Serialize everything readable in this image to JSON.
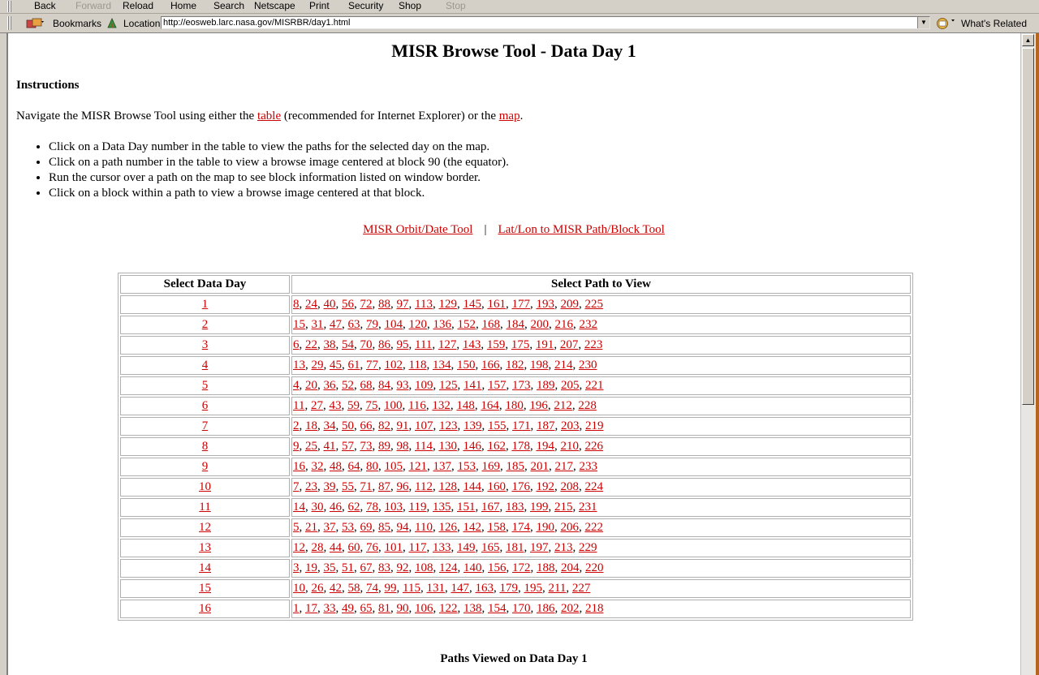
{
  "nav": {
    "back": "Back",
    "forward": "Forward",
    "reload": "Reload",
    "home": "Home",
    "search": "Search",
    "netscape": "Netscape",
    "print": "Print",
    "security": "Security",
    "shop": "Shop",
    "stop": "Stop"
  },
  "location_bar": {
    "bookmarks": "Bookmarks",
    "location_label": "Location:",
    "url": "http://eosweb.larc.nasa.gov/MISRBR/day1.html",
    "whats_related": "What's Related"
  },
  "page": {
    "title": "MISR Browse Tool - Data Day 1",
    "instructions_heading": "Instructions",
    "intro": {
      "before": "Navigate the MISR Browse Tool using either the ",
      "link_table": "table",
      "middle": " (recommended for Internet Explorer) or the ",
      "link_map": "map",
      "after": "."
    },
    "bullets": [
      "Click on a Data Day number in the table to view the paths for the selected day on the map.",
      "Click on a path number in the table to view a browse image centered at block 90 (the equator).",
      "Run the cursor over a path on the map to see block information listed on window border.",
      "Click on a block within a path to view a browse image centered at that block."
    ],
    "tool_links": {
      "orbit_date": "MISR Orbit/Date Tool",
      "separator": "|",
      "latlon": "Lat/Lon to MISR Path/Block Tool"
    },
    "table": {
      "col_day": "Select Data Day",
      "col_paths": "Select Path to View",
      "rows": [
        {
          "day": "1",
          "paths": [
            "8",
            "24",
            "40",
            "56",
            "72",
            "88",
            "97",
            "113",
            "129",
            "145",
            "161",
            "177",
            "193",
            "209",
            "225"
          ]
        },
        {
          "day": "2",
          "paths": [
            "15",
            "31",
            "47",
            "63",
            "79",
            "104",
            "120",
            "136",
            "152",
            "168",
            "184",
            "200",
            "216",
            "232"
          ]
        },
        {
          "day": "3",
          "paths": [
            "6",
            "22",
            "38",
            "54",
            "70",
            "86",
            "95",
            "111",
            "127",
            "143",
            "159",
            "175",
            "191",
            "207",
            "223"
          ]
        },
        {
          "day": "4",
          "paths": [
            "13",
            "29",
            "45",
            "61",
            "77",
            "102",
            "118",
            "134",
            "150",
            "166",
            "182",
            "198",
            "214",
            "230"
          ]
        },
        {
          "day": "5",
          "paths": [
            "4",
            "20",
            "36",
            "52",
            "68",
            "84",
            "93",
            "109",
            "125",
            "141",
            "157",
            "173",
            "189",
            "205",
            "221"
          ]
        },
        {
          "day": "6",
          "paths": [
            "11",
            "27",
            "43",
            "59",
            "75",
            "100",
            "116",
            "132",
            "148",
            "164",
            "180",
            "196",
            "212",
            "228"
          ]
        },
        {
          "day": "7",
          "paths": [
            "2",
            "18",
            "34",
            "50",
            "66",
            "82",
            "91",
            "107",
            "123",
            "139",
            "155",
            "171",
            "187",
            "203",
            "219"
          ]
        },
        {
          "day": "8",
          "paths": [
            "9",
            "25",
            "41",
            "57",
            "73",
            "89",
            "98",
            "114",
            "130",
            "146",
            "162",
            "178",
            "194",
            "210",
            "226"
          ]
        },
        {
          "day": "9",
          "paths": [
            "16",
            "32",
            "48",
            "64",
            "80",
            "105",
            "121",
            "137",
            "153",
            "169",
            "185",
            "201",
            "217",
            "233"
          ]
        },
        {
          "day": "10",
          "paths": [
            "7",
            "23",
            "39",
            "55",
            "71",
            "87",
            "96",
            "112",
            "128",
            "144",
            "160",
            "176",
            "192",
            "208",
            "224"
          ]
        },
        {
          "day": "11",
          "paths": [
            "14",
            "30",
            "46",
            "62",
            "78",
            "103",
            "119",
            "135",
            "151",
            "167",
            "183",
            "199",
            "215",
            "231"
          ]
        },
        {
          "day": "12",
          "paths": [
            "5",
            "21",
            "37",
            "53",
            "69",
            "85",
            "94",
            "110",
            "126",
            "142",
            "158",
            "174",
            "190",
            "206",
            "222"
          ]
        },
        {
          "day": "13",
          "paths": [
            "12",
            "28",
            "44",
            "60",
            "76",
            "101",
            "117",
            "133",
            "149",
            "165",
            "181",
            "197",
            "213",
            "229"
          ]
        },
        {
          "day": "14",
          "paths": [
            "3",
            "19",
            "35",
            "51",
            "67",
            "83",
            "92",
            "108",
            "124",
            "140",
            "156",
            "172",
            "188",
            "204",
            "220"
          ]
        },
        {
          "day": "15",
          "paths": [
            "10",
            "26",
            "42",
            "58",
            "74",
            "99",
            "115",
            "131",
            "147",
            "163",
            "179",
            "195",
            "211",
            "227"
          ]
        },
        {
          "day": "16",
          "paths": [
            "1",
            "17",
            "33",
            "49",
            "65",
            "81",
            "90",
            "106",
            "122",
            "138",
            "154",
            "170",
            "186",
            "202",
            "218"
          ]
        }
      ]
    },
    "viewed_heading": "Paths Viewed on Data Day 1"
  },
  "colors": {
    "link": "#cc0000",
    "chrome": "#d4d0c8",
    "side_strip": "#b5651d"
  }
}
